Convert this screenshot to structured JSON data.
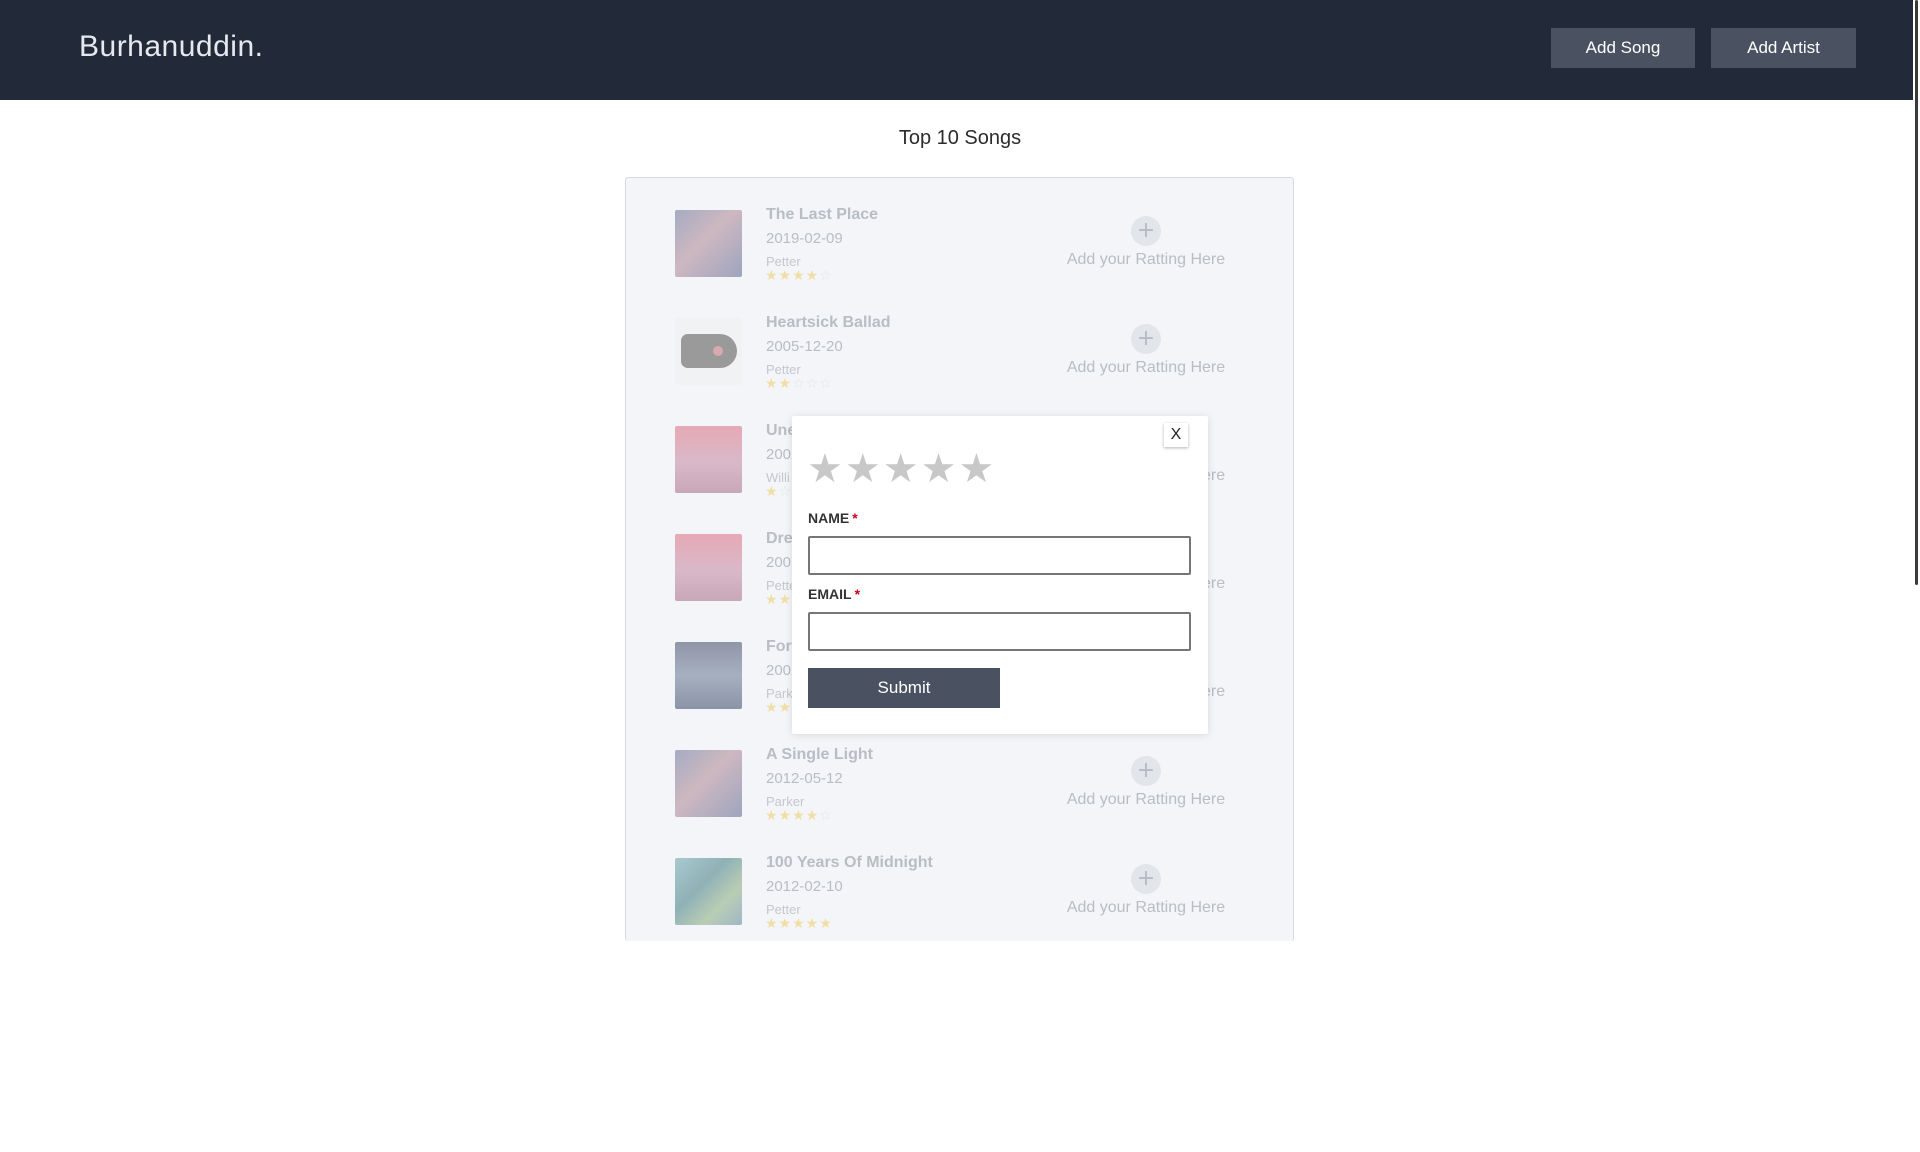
{
  "header": {
    "brand": "Burhanuddin.",
    "add_song_label": "Add Song",
    "add_artist_label": "Add Artist"
  },
  "main": {
    "heading": "Top 10 Songs",
    "rating_prompt": "Add your Ratting Here",
    "plus_glyph": "+",
    "songs": [
      {
        "title": "The Last Place",
        "date": "2019-02-09",
        "artist": "Petter",
        "rating": 4
      },
      {
        "title": "Heartsick Ballad",
        "date": "2005-12-20",
        "artist": "Petter",
        "rating": 2
      },
      {
        "title": "Une",
        "date": "200",
        "artist": "Willi",
        "rating": 1
      },
      {
        "title": "Dre",
        "date": "200",
        "artist": "Pette",
        "rating": 2
      },
      {
        "title": "For",
        "date": "200",
        "artist": "Park",
        "rating": 2
      },
      {
        "title": "A Single Light",
        "date": "2012-05-12",
        "artist": "Parker",
        "rating": 4
      },
      {
        "title": "100 Years Of Midnight",
        "date": "2012-02-10",
        "artist": "Petter",
        "rating": 5
      }
    ]
  },
  "modal": {
    "close_label": "X",
    "stars": "★★★★★",
    "name_label": "NAME",
    "email_label": "EMAIL",
    "required_mark": "*",
    "name_value": "",
    "email_value": "",
    "submit_label": "Submit"
  },
  "colors": {
    "navbar": "#222a3a",
    "button": "#4a5262",
    "star_filled": "#f0dea4",
    "required": "#d0021b"
  }
}
